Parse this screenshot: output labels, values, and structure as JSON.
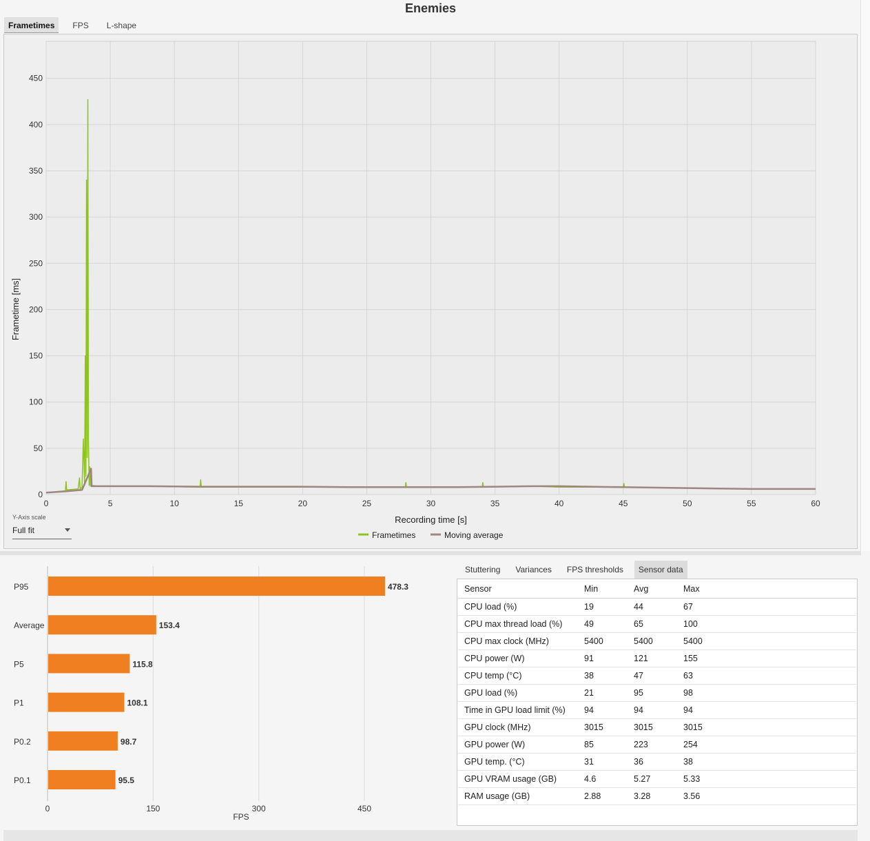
{
  "page_title": "Enemies",
  "top_tabs": [
    {
      "label": "Frametimes",
      "active": true
    },
    {
      "label": "FPS",
      "active": false
    },
    {
      "label": "L-shape",
      "active": false
    }
  ],
  "y_axis_scale": {
    "label": "Y-Axis scale",
    "value": "Full fit"
  },
  "sensor_tabs": [
    {
      "label": "Stuttering",
      "active": false
    },
    {
      "label": "Variances",
      "active": false
    },
    {
      "label": "FPS thresholds",
      "active": false
    },
    {
      "label": "Sensor data",
      "active": true
    }
  ],
  "sensor_table": {
    "headers": [
      "Sensor",
      "Min",
      "Avg",
      "Max"
    ],
    "rows": [
      [
        "CPU load (%)",
        "19",
        "44",
        "67"
      ],
      [
        "CPU max thread load (%)",
        "49",
        "65",
        "100"
      ],
      [
        "CPU max clock (MHz)",
        "5400",
        "5400",
        "5400"
      ],
      [
        "CPU power (W)",
        "91",
        "121",
        "155"
      ],
      [
        "CPU temp (°C)",
        "38",
        "47",
        "63"
      ],
      [
        "GPU load (%)",
        "21",
        "95",
        "98"
      ],
      [
        "Time in GPU load limit (%)",
        "94",
        "94",
        "94"
      ],
      [
        "GPU clock (MHz)",
        "3015",
        "3015",
        "3015"
      ],
      [
        "GPU power (W)",
        "85",
        "223",
        "254"
      ],
      [
        "GPU temp. (°C)",
        "31",
        "36",
        "38"
      ],
      [
        "GPU VRAM usage (GB)",
        "4.6",
        "5.27",
        "5.33"
      ],
      [
        "RAM usage (GB)",
        "2.88",
        "3.28",
        "3.56"
      ]
    ]
  },
  "chart_data": [
    {
      "type": "line",
      "title": "",
      "xlabel": "Recording time [s]",
      "ylabel": "Frametime [ms]",
      "xlim": [
        0,
        60
      ],
      "ylim": [
        0,
        490
      ],
      "xticks": [
        0,
        5,
        10,
        15,
        20,
        25,
        30,
        35,
        40,
        45,
        50,
        55,
        60
      ],
      "yticks": [
        0,
        50,
        100,
        150,
        200,
        250,
        300,
        350,
        400,
        450
      ],
      "grid": true,
      "legend_position": "bottom-center",
      "series": [
        {
          "name": "Frametimes",
          "color": "#8fc31f",
          "x": [
            0,
            1.5,
            1.55,
            1.6,
            2.5,
            2.6,
            2.65,
            2.8,
            2.9,
            3.0,
            3.05,
            3.1,
            3.15,
            3.2,
            3.25,
            3.3,
            3.35,
            3.4,
            3.45,
            3.5,
            4,
            8,
            12,
            12.05,
            12.1,
            16,
            20,
            24,
            28,
            28.05,
            28.1,
            32,
            34,
            34.05,
            34.1,
            38,
            40,
            45,
            45.05,
            45.1,
            50,
            55,
            60
          ],
          "y": [
            2,
            4,
            14,
            5,
            6,
            18,
            6,
            8,
            60,
            10,
            150,
            20,
            340,
            40,
            427,
            60,
            10,
            30,
            9,
            10,
            9,
            9,
            8,
            16,
            8,
            8,
            8,
            8,
            8,
            13,
            8,
            8,
            8,
            13,
            8,
            9,
            8,
            8,
            12,
            8,
            7,
            6,
            6
          ]
        },
        {
          "name": "Moving average",
          "color": "#9e8680",
          "x": [
            0,
            1,
            2,
            2.8,
            3.2,
            3.5,
            3.55,
            4,
            8,
            12,
            16,
            20,
            24,
            28,
            32,
            35,
            38,
            40,
            45,
            50,
            55,
            60
          ],
          "y": [
            2,
            3,
            4,
            5,
            18,
            28,
            9,
            9,
            9,
            8.5,
            8.5,
            8.5,
            8,
            8,
            8,
            8.5,
            9,
            9,
            8,
            7,
            6,
            6
          ]
        }
      ]
    },
    {
      "type": "bar",
      "orientation": "horizontal",
      "title": "",
      "xlabel": "FPS",
      "xlim": [
        0,
        480
      ],
      "xticks": [
        0,
        150,
        300,
        450
      ],
      "categories": [
        "P95",
        "Average",
        "P5",
        "P1",
        "P0.2",
        "P0.1"
      ],
      "values": [
        478.3,
        153.4,
        115.8,
        108.1,
        98.7,
        95.5
      ],
      "color": "#f07f22"
    }
  ]
}
